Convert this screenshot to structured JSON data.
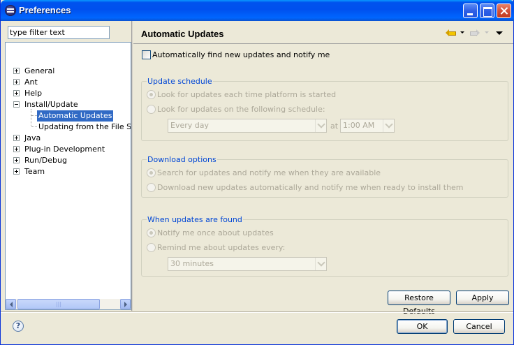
{
  "window": {
    "title": "Preferences"
  },
  "filter": {
    "placeholder": "type filter text"
  },
  "tree": {
    "items": [
      {
        "label": "General",
        "expanded": false
      },
      {
        "label": "Ant",
        "expanded": false
      },
      {
        "label": "Help",
        "expanded": false
      },
      {
        "label": "Install/Update",
        "expanded": true
      },
      {
        "label": "Automatic Updates",
        "selected": true
      },
      {
        "label": "Updating from the File Syst"
      },
      {
        "label": "Java",
        "expanded": false
      },
      {
        "label": "Plug-in Development",
        "expanded": false
      },
      {
        "label": "Run/Debug",
        "expanded": false
      },
      {
        "label": "Team",
        "expanded": false
      }
    ]
  },
  "page": {
    "title": "Automatic Updates",
    "auto_find_label": "Automatically find new updates and notify me",
    "auto_find_checked": false
  },
  "schedule": {
    "title": "Update schedule",
    "option_startup": "Look for updates each time platform is started",
    "option_schedule": "Look for updates on the following schedule:",
    "selected": "startup",
    "day_value": "Every day",
    "at_label": "at",
    "time_value": "1:00 AM"
  },
  "download": {
    "title": "Download options",
    "option_notify": "Search for updates and notify me when they are available",
    "option_auto": "Download new updates automatically and notify me when ready to install them",
    "selected": "notify"
  },
  "found": {
    "title": "When updates are found",
    "option_once": "Notify me once about updates",
    "option_remind": "Remind me about updates every:",
    "selected": "once",
    "remind_value": "30 minutes"
  },
  "buttons": {
    "restore_defaults": "Restore Defaults",
    "apply": "Apply",
    "ok": "OK",
    "cancel": "Cancel",
    "help": "?"
  },
  "colors": {
    "titlebar": "#0053ee",
    "selection": "#316ac5",
    "group_title": "#0046d5",
    "disabled_text": "#aca899"
  }
}
